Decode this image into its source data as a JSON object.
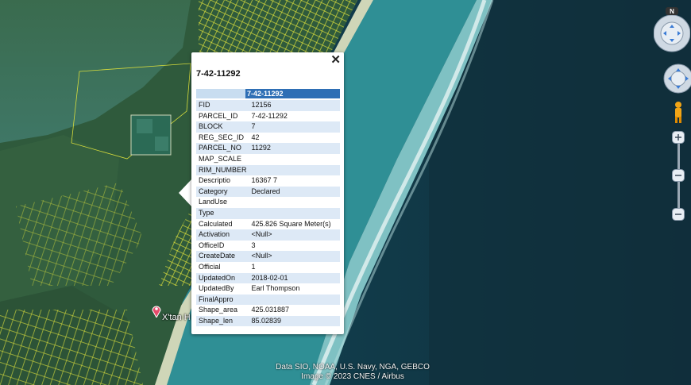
{
  "popup": {
    "close_glyph": "✕",
    "title": "7-42-11292",
    "header_value": "7-42-11292",
    "rows": [
      {
        "key": "FID",
        "value": "12156"
      },
      {
        "key": "PARCEL_ID",
        "value": "7-42-11292"
      },
      {
        "key": "BLOCK",
        "value": "7"
      },
      {
        "key": "REG_SEC_ID",
        "value": "42"
      },
      {
        "key": "PARCEL_NO",
        "value": "11292"
      },
      {
        "key": "MAP_SCALE",
        "value": ""
      },
      {
        "key": "RIM_NUMBER",
        "value": ""
      },
      {
        "key": "Descriptio",
        "value": "16367 7"
      },
      {
        "key": "Category",
        "value": "Declared"
      },
      {
        "key": "LandUse",
        "value": ""
      },
      {
        "key": "Type",
        "value": ""
      },
      {
        "key": "Calculated",
        "value": "425.826 Square Meter(s)"
      },
      {
        "key": "Activation",
        "value": "<Null>"
      },
      {
        "key": "OfficeID",
        "value": "3"
      },
      {
        "key": "CreateDate",
        "value": "<Null>"
      },
      {
        "key": "Official",
        "value": "1"
      },
      {
        "key": "UpdatedOn",
        "value": "2018-02-01"
      },
      {
        "key": "UpdatedBy",
        "value": "Earl Thompson"
      },
      {
        "key": "FinalAppro",
        "value": ""
      },
      {
        "key": "Shape_area",
        "value": "425.031887"
      },
      {
        "key": "Shape_len",
        "value": "85.02839"
      }
    ]
  },
  "marker": {
    "label": "X'tan H"
  },
  "attribution": {
    "line1": "Data SIO, NOAA, U.S. Navy, NGA, GEBCO",
    "line2": "Image © 2023 CNES / Airbus"
  },
  "controls": {
    "compass_north": "N"
  },
  "colors": {
    "parcel_lines": "#e8e84a",
    "header_bar": "#2e6fb5",
    "row_alt": "#dde9f6"
  }
}
